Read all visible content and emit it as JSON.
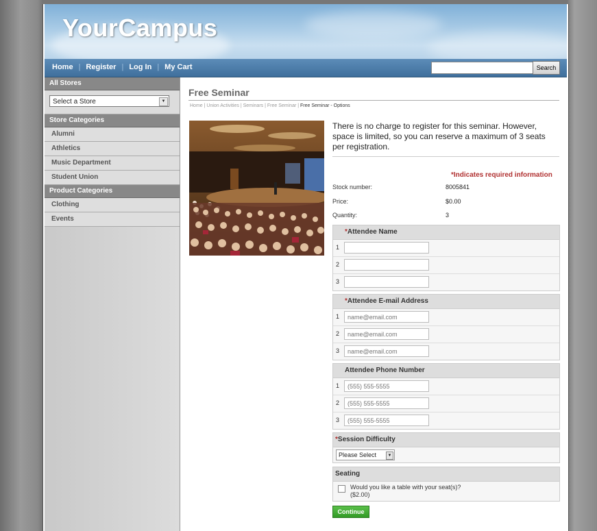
{
  "site": {
    "logo": "YourCampus"
  },
  "nav": {
    "links": [
      "Home",
      "Register",
      "Log In",
      "My Cart"
    ],
    "search_value": "",
    "search_button": "Search"
  },
  "sidebar": {
    "all_stores_header": "All Stores",
    "store_select_value": "Select a Store",
    "store_categories_header": "Store Categories",
    "store_categories": [
      "Alumni",
      "Athletics",
      "Music Department",
      "Student Union"
    ],
    "product_categories_header": "Product Categories",
    "product_categories": [
      "Clothing",
      "Events"
    ]
  },
  "main": {
    "title": "Free Seminar",
    "breadcrumb": [
      "Home",
      "Union Activities",
      "Seminars",
      "Free Seminar"
    ],
    "breadcrumb_current": "Free Seminar - Options",
    "description": "There is no charge to register for this seminar. However, space is limited, so you can reserve a maximum of 3 seats per registration.",
    "required_note": "*Indicates required information",
    "stock_label": "Stock number:",
    "stock_value": "8005841",
    "price_label": "Price:",
    "price_value": "$0.00",
    "quantity_label": "Quantity:",
    "quantity_value": "3",
    "attendee_name": {
      "required_mark": "*",
      "header": "Attendee Name",
      "rows": [
        {
          "num": "1",
          "placeholder": ""
        },
        {
          "num": "2",
          "placeholder": ""
        },
        {
          "num": "3",
          "placeholder": ""
        }
      ]
    },
    "attendee_email": {
      "required_mark": "*",
      "header": "Attendee E-mail Address",
      "rows": [
        {
          "num": "1",
          "placeholder": "name@email.com"
        },
        {
          "num": "2",
          "placeholder": "name@email.com"
        },
        {
          "num": "3",
          "placeholder": "name@email.com"
        }
      ]
    },
    "attendee_phone": {
      "header": "Attendee Phone Number",
      "rows": [
        {
          "num": "1",
          "placeholder": "(555) 555-5555"
        },
        {
          "num": "2",
          "placeholder": "(555) 555-5555"
        },
        {
          "num": "3",
          "placeholder": "(555) 555-5555"
        }
      ]
    },
    "session_difficulty": {
      "required_mark": "*",
      "header": "Session Difficulty",
      "selected": "Please Select"
    },
    "seating": {
      "header": "Seating",
      "checkbox_label": "Would you like a table with your seat(s)?($2.00)"
    },
    "continue_button": "Continue"
  }
}
